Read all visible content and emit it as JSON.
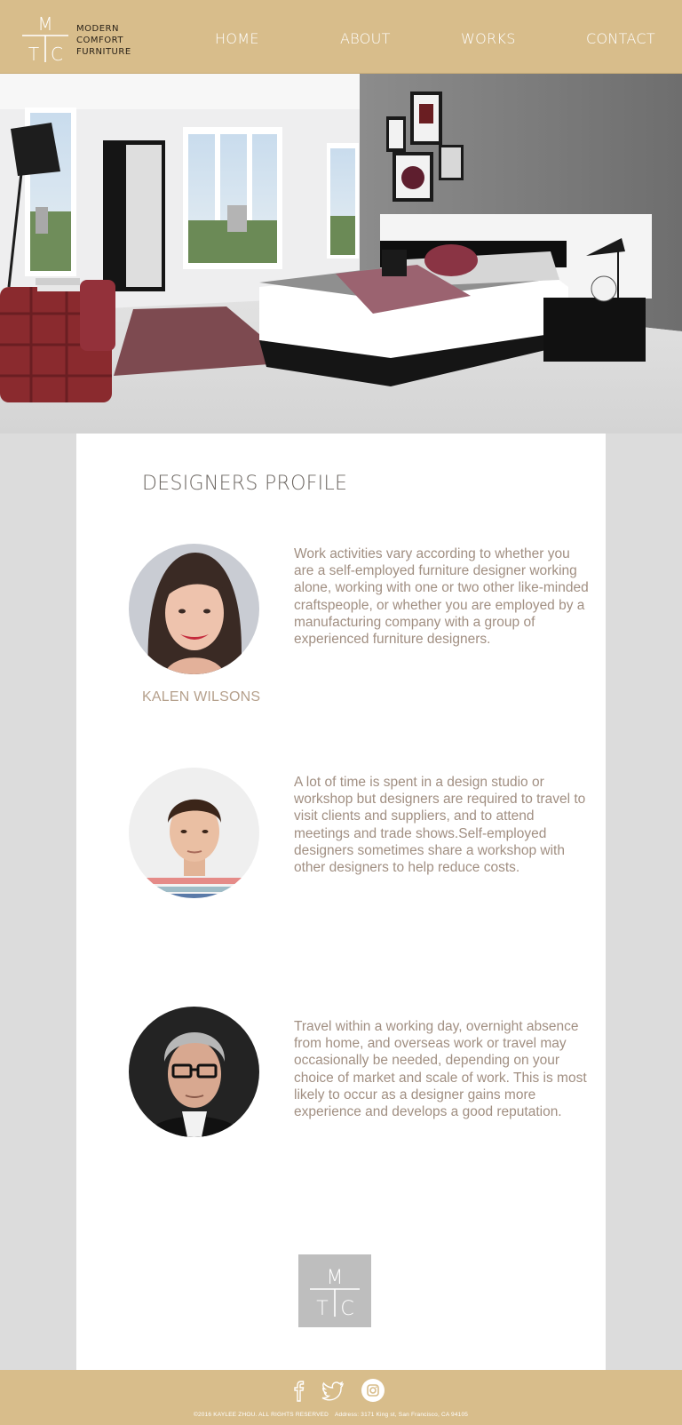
{
  "brand": {
    "mark_top": "M",
    "mark_left": "T",
    "mark_right": "C",
    "line1": "MODERN",
    "line2": "COMFORT",
    "line3": "FURNITURE"
  },
  "nav": {
    "home": "HOME",
    "about": "ABOUT",
    "works": "WORKS",
    "contact": "CONTACT"
  },
  "hero": {
    "image_icon": "bedroom-photo"
  },
  "profile": {
    "title": "DESIGNERS PROFILE",
    "designers": [
      {
        "name": "KALEN WILSONS",
        "bio": "Work activities vary according to whether you are a self-employed furniture designer working alone, working with one or two other like-minded craftspeople, or whether you are employed by a manufacturing company with a group of experienced furniture designers."
      },
      {
        "name": "",
        "bio": "A lot of time is spent in a design studio or workshop but designers are required to travel to visit clients and suppliers, and to attend meetings and trade shows.Self-employed designers sometimes share a workshop with other designers to help reduce costs."
      },
      {
        "name": "",
        "bio": "Travel within a working day, overnight absence from home, and overseas work or travel may occasionally be needed, depending on your choice of market and scale of work. This is most likely to occur as a designer gains more experience and develops a good reputation."
      }
    ]
  },
  "footer": {
    "social_icons": [
      "facebook-icon",
      "twitter-icon",
      "instagram-icon"
    ],
    "copyright": "©2016 KAYLEE ZHOU.  ALL RIGHTS RESERVED",
    "address": "Address: 3171 King st, San Francisco, CA 94105"
  },
  "colors": {
    "header_bg": "#d8bd8b",
    "page_bg": "#dcdcdc",
    "bio_text": "#a18f82",
    "name_text": "#b5a08c"
  }
}
